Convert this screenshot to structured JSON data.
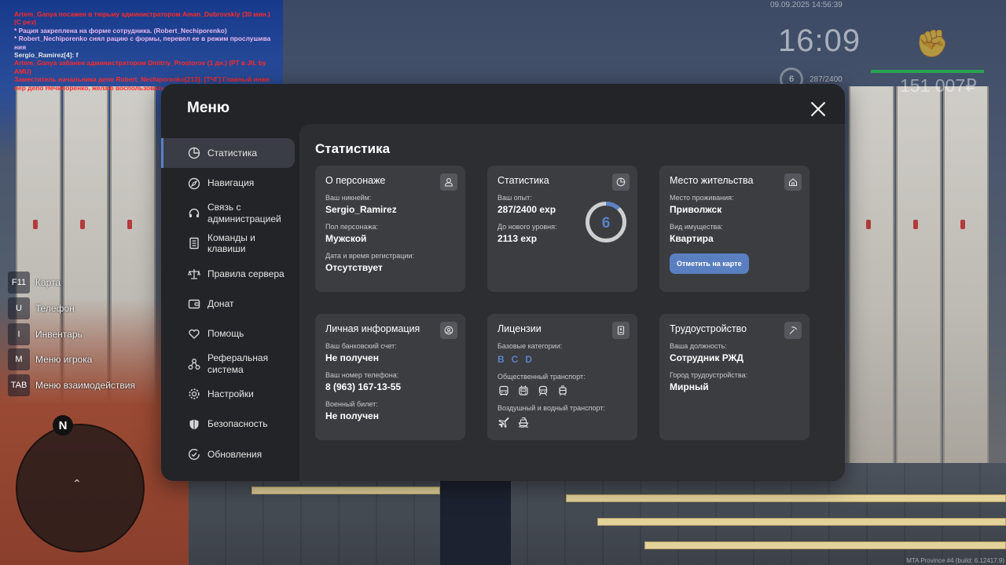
{
  "chat": [
    {
      "text": "Artem_Ganya посажен в тюрьму администратором Aman_Dubrovskiy (30 мин.) (С рез)",
      "color": "red"
    },
    {
      "text": " * Рация закреплена на форме сотрудника. (Robert_Nechiporenko)",
      "color": "pink"
    },
    {
      "text": " * Robert_Nechiporenko снял рацию с формы, перевел ее в режим прослушива ния",
      "color": "pink"
    },
    {
      "text": "Sergio_Ramirez[4]: f",
      "color": "white"
    },
    {
      "text": "Artem_Ganya забанен администратором Dmitriy_Prostorov (1 дн.) (PT в JIL by  AMU)",
      "color": "red"
    },
    {
      "text": "Заместитель начальника депо Robert_Nechiporenko[213]: [ТЧГ] Главный инже нер депо Нечипоренко, желаю воспользоваться АСКД.",
      "color": "red"
    }
  ],
  "datetime": "09.09.2025 14:56:39",
  "hud": {
    "time": "16:09",
    "level": "6",
    "exp": "287/2400",
    "money": "151 007₽",
    "fist_icon": "fist-icon"
  },
  "hotkeys": [
    {
      "key": "F11",
      "label": "Карта"
    },
    {
      "key": "U",
      "label": "Телефон"
    },
    {
      "key": "I",
      "label": "Инвентарь"
    },
    {
      "key": "M",
      "label": "Меню игрока"
    },
    {
      "key": "TAB",
      "label": "Меню взаимодействия"
    }
  ],
  "minimap": {
    "north": "N"
  },
  "build": "MTA Province #4 (build: 6.12417.9)",
  "menu": {
    "title": "Меню",
    "sidebar": [
      {
        "label": "Статистика",
        "icon": "pie-chart-icon",
        "active": true
      },
      {
        "label": "Навигация",
        "icon": "compass-icon"
      },
      {
        "label": "Связь с администрацией",
        "icon": "headset-icon"
      },
      {
        "label": "Команды и клавиши",
        "icon": "document-icon"
      },
      {
        "label": "Правила сервера",
        "icon": "scales-icon"
      },
      {
        "label": "Донат",
        "icon": "wallet-icon"
      },
      {
        "label": "Помощь",
        "icon": "heart-hands-icon"
      },
      {
        "label": "Реферальная система",
        "icon": "network-icon"
      },
      {
        "label": "Настройки",
        "icon": "gear-icon"
      },
      {
        "label": "Безопасность",
        "icon": "shield-icon"
      },
      {
        "label": "Обновления",
        "icon": "update-icon"
      }
    ],
    "content": {
      "title": "Статистика",
      "character": {
        "title": "О персонаже",
        "icon": "user-icon",
        "nickname_label": "Ваш никнейм:",
        "nickname": "Sergio_Ramirez",
        "gender_label": "Пол персонажа:",
        "gender": "Мужской",
        "reg_label": "Дата и время регистрации:",
        "reg": "Отсутствует"
      },
      "stats": {
        "title": "Статистика",
        "icon": "pie-chart-icon",
        "exp_label": "Ваш опыт:",
        "exp": "287/2400 exp",
        "next_label": "До нового уровня:",
        "next": "2113 exp",
        "level": "6",
        "progress": 0.12
      },
      "residence": {
        "title": "Место жительства",
        "icon": "home-icon",
        "place_label": "Место проживания:",
        "place": "Приволжск",
        "property_label": "Вид имущества:",
        "property": "Квартира",
        "button": "Отметить на карте"
      },
      "personal": {
        "title": "Личная информация",
        "icon": "id-icon",
        "bank_label": "Ваш банковский счет:",
        "bank": "Не получен",
        "phone_label": "Ваш номер телефона:",
        "phone": "8 (963) 167-13-55",
        "military_label": "Военный билет:",
        "military": "Не получен"
      },
      "licenses": {
        "title": "Лицензии",
        "icon": "license-icon",
        "base_label": "Базовые категории:",
        "base": [
          "B",
          "C",
          "D"
        ],
        "public_label": "Общественный транспорт:",
        "public_icons": [
          "bus-icon",
          "trolleybus-icon",
          "train-icon",
          "tram-icon"
        ],
        "air_label": "Воздушный и водный транспорт:",
        "air_icons": [
          "plane-icon",
          "ship-icon"
        ]
      },
      "employment": {
        "title": "Трудоустройство",
        "icon": "pickaxe-icon",
        "position_label": "Ваша должность:",
        "position": "Сотрудник РЖД",
        "city_label": "Город трудоустройства:",
        "city": "Мирный"
      }
    }
  }
}
